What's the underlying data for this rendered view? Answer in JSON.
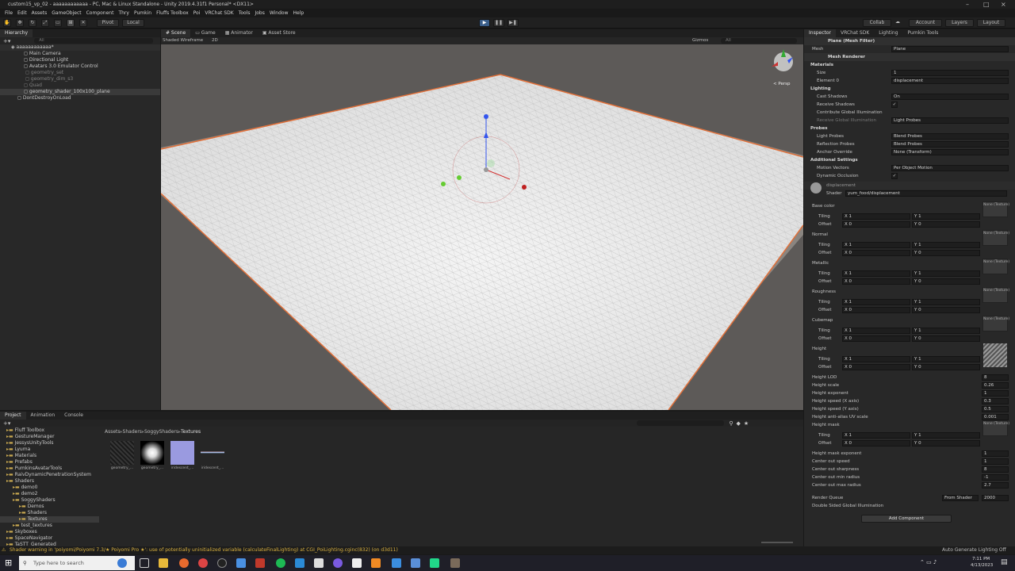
{
  "titlebar": {
    "title": "custom15_vp_02 - aaaaaaaaaaaa - PC, Mac & Linux Standalone - Unity 2019.4.31f1 Personal* <DX11>"
  },
  "menu": [
    "File",
    "Edit",
    "Assets",
    "GameObject",
    "Component",
    "Thry",
    "Pumkin",
    "Fluffs Toolbox",
    "Poi",
    "VRChat SDK",
    "Tools",
    "Jobs",
    "Window",
    "Help"
  ],
  "toolbar": {
    "pivot": "Pivot",
    "local": "Local",
    "collab": "Collab",
    "account": "Account",
    "layers": "Layers",
    "layout": "Layout"
  },
  "hierarchy": {
    "tab": "Hierarchy",
    "search_placeholder": "All",
    "scene": "aaaaaaaaaaaa*",
    "items": [
      "Main Camera",
      "Directional Light",
      "Avatars 3.0 Emulator Control",
      "geometry_set",
      "geometry_dim_s3",
      "Quad",
      "geometry_shader_100x100_plane",
      "DontDestroyOnLoad"
    ]
  },
  "scene": {
    "tabs": [
      "Scene",
      "Game",
      "Animator",
      "Asset Store"
    ],
    "shading": "Shaded Wireframe",
    "mode": "2D",
    "gizmos": "Gizmos",
    "search": "All",
    "persp": "< Persp"
  },
  "project": {
    "tabs": [
      "Project",
      "Animation",
      "Console"
    ],
    "breadcrumb": [
      "Assets",
      "Shaders",
      "SoggyShaders",
      "Textures"
    ],
    "tree": [
      "Fluff Toolbox",
      "GestureManager",
      "JessysUnityTools",
      "Lyuma",
      "Materials",
      "Prefabs",
      "PumkinsAvatarTools",
      "RaivDynamicPenetrationSystem",
      "Shaders",
      "demo0",
      "demo2",
      "SoggyShaders",
      "Demos",
      "Shaders",
      "Textures",
      "test_textures",
      "Skyboxes",
      "SpaceNavigator",
      "TaSTT_Generated"
    ],
    "assets": [
      "geometry_...",
      "geometry_...",
      "iridescent_...",
      "iridescent_..."
    ]
  },
  "inspector": {
    "tabs": [
      "Inspector",
      "VRChat SDK",
      "Lighting",
      "Pumkin Tools"
    ],
    "meshfilter": "Plane (Mesh Filter)",
    "mesh_label": "Mesh",
    "mesh_value": "Plane",
    "meshrenderer": "Mesh Renderer",
    "materials": "Materials",
    "size_label": "Size",
    "size_value": "1",
    "element_label": "Element 0",
    "element_value": "displacement",
    "lighting": "Lighting",
    "cast_label": "Cast Shadows",
    "cast_value": "On",
    "receive_label": "Receive Shadows",
    "contrib_label": "Contribute Global Illumination",
    "receive_gi_label": "Receive Global Illumination",
    "receive_gi_value": "Light Probes",
    "probes": "Probes",
    "lightprobes_label": "Light Probes",
    "lightprobes_value": "Blend Probes",
    "reflection_label": "Reflection Probes",
    "reflection_value": "Blend Probes",
    "anchor_label": "Anchor Override",
    "anchor_value": "None (Transform)",
    "additional": "Additional Settings",
    "motion_label": "Motion Vectors",
    "motion_value": "Per Object Motion",
    "occlusion_label": "Dynamic Occlusion",
    "material_name": "displacement",
    "shader_label": "Shader",
    "shader_value": "yum_food/displacement",
    "tex_sections": [
      "Base color",
      "Normal",
      "Metallic",
      "Roughness",
      "Cubemap",
      "Height"
    ],
    "tiling": "Tiling",
    "offset": "Offset",
    "x1": "X 1",
    "y1": "Y 1",
    "x0": "X 0",
    "y0": "Y 0",
    "none_texture": "None (Texture)",
    "none_cubemap": "None (Cubemap)",
    "select": "Select",
    "props": [
      [
        "Height LOD",
        "8"
      ],
      [
        "Height scale",
        "0.26"
      ],
      [
        "Height exponent",
        "1"
      ],
      [
        "Height speed (X axis)",
        "0.3"
      ],
      [
        "Height speed (Y axis)",
        "0.5"
      ],
      [
        "Height anti-alias UV scale",
        "0.001"
      ]
    ],
    "height_mask": "Height mask",
    "props2": [
      [
        "Height mask exponent",
        "1"
      ],
      [
        "Center out speed",
        "1"
      ],
      [
        "Center out sharpness",
        "8"
      ],
      [
        "Center out min radius",
        "-1"
      ],
      [
        "Center out max radius",
        "2.7"
      ]
    ],
    "render_queue_label": "Render Queue",
    "render_queue_mode": "From Shader",
    "render_queue_value": "2000",
    "double_sided": "Double Sided Global Illumination",
    "add_component": "Add Component"
  },
  "status": {
    "warning": "Shader warning in 'poiyomi/Poiyomi 7.3/★ Poiyomi Pro ★': use of potentially uninitialized variable (calculateFinalLighting) at CGI_PoiLighting.cginc(832) (on d3d11)",
    "right": "Auto Generate Lighting Off"
  },
  "taskbar": {
    "search": "Type here to search",
    "time": "7:11 PM",
    "date": "4/13/2023"
  }
}
